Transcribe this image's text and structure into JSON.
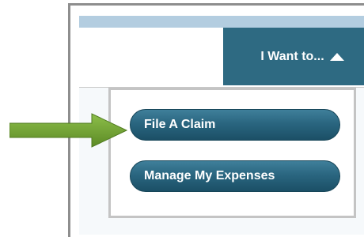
{
  "header": {
    "menu_label": "I Want to...",
    "menu_icon": "caret-up-icon"
  },
  "dropdown": {
    "items": [
      {
        "label": "File A Claim"
      },
      {
        "label": "Manage My Expenses"
      }
    ]
  },
  "annotation": {
    "pointer_icon": "arrow-right-icon",
    "pointer_color": "#6a9a2c"
  },
  "colors": {
    "button_primary": "#2e6a82",
    "header_strip": "#b3cde0"
  }
}
